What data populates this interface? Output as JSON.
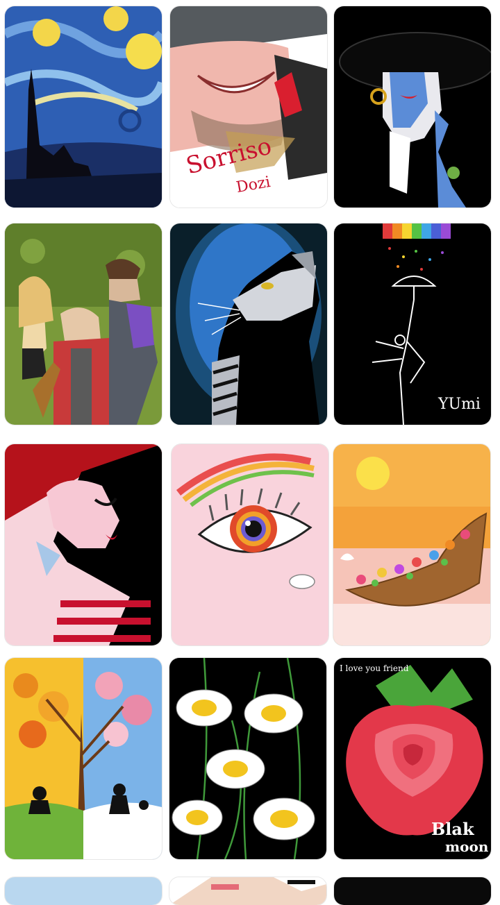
{
  "gallery": {
    "artworks": [
      {
        "title": "starry-night-drawing"
      },
      {
        "title": "smile-drawing",
        "caption_line1": "Sorriso",
        "caption_line2": "Dozi"
      },
      {
        "title": "woman-in-black-hat-drawing"
      },
      {
        "title": "three-survivors-drawing"
      },
      {
        "title": "cat-looking-up-drawing"
      },
      {
        "title": "rainbow-umbrella-dancer-drawing",
        "signature": "YUmi"
      },
      {
        "title": "woman-red-hat-profile-drawing"
      },
      {
        "title": "rainbow-eye-drawing"
      },
      {
        "title": "flower-boat-sunset-drawing"
      },
      {
        "title": "autumn-winter-tree-drawing"
      },
      {
        "title": "daisies-on-black-drawing"
      },
      {
        "title": "red-rose-drawing",
        "caption": "I love you friend",
        "signature_line1": "Blak",
        "signature_line2": "moon"
      }
    ]
  },
  "colors": {
    "background": "#ffffff",
    "card_border": "#e6e6e6"
  }
}
